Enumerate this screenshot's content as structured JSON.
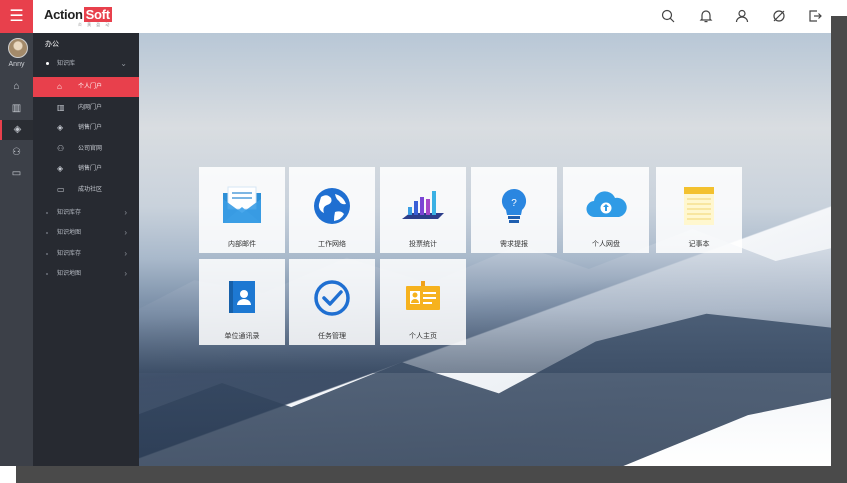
{
  "header": {
    "logo_text": "Action",
    "logo_box_text": "Soft",
    "logo_sub": "炎 黄 盈 动"
  },
  "rail": {
    "menu_icon": "hamburger-icon",
    "user_name": "Anny",
    "icons": [
      "home-icon",
      "building-icon",
      "graduation-cap-icon",
      "users-icon",
      "monitor-icon"
    ]
  },
  "sidebar": {
    "title": "办公",
    "group_main": "知识库",
    "items": [
      {
        "label": "个人门户",
        "icon": "home-icon",
        "active": true
      },
      {
        "label": "内网门户",
        "icon": "building-icon",
        "active": false
      },
      {
        "label": "销售门户",
        "icon": "graduation-cap-icon",
        "active": false
      },
      {
        "label": "公司官网",
        "icon": "users-icon",
        "active": false
      },
      {
        "label": "销售门户",
        "icon": "graduation-cap-icon",
        "active": false
      },
      {
        "label": "成功社区",
        "icon": "monitor-icon",
        "active": false
      }
    ],
    "groups": [
      "知识库存",
      "知识地图",
      "知识库存",
      "知识地图"
    ]
  },
  "tiles": [
    {
      "label": "内部邮件",
      "icon": "mail-icon"
    },
    {
      "label": "工作网络",
      "icon": "globe-icon"
    },
    {
      "label": "投票统计",
      "icon": "bar-chart-icon"
    },
    {
      "label": "需求提报",
      "icon": "lightbulb-icon"
    },
    {
      "label": "个人网盘",
      "icon": "cloud-upload-icon"
    },
    {
      "label": "记事本",
      "icon": "notepad-icon"
    },
    {
      "label": "单位通讯录",
      "icon": "contacts-icon"
    },
    {
      "label": "任务管理",
      "icon": "check-circle-icon"
    },
    {
      "label": "个人主页",
      "icon": "id-card-icon"
    }
  ],
  "colors": {
    "accent": "#e8404c",
    "rail": "#3c4048",
    "sidebar": "#272a31"
  }
}
